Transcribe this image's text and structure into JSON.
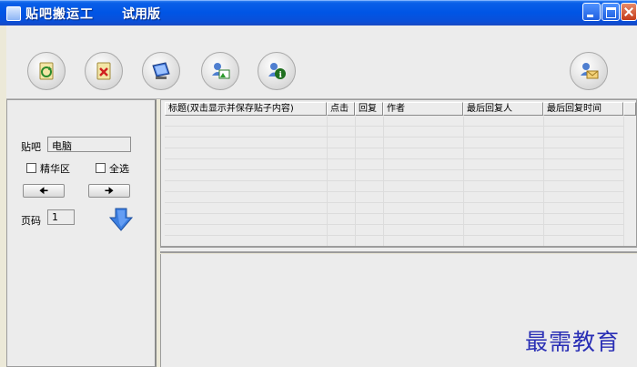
{
  "window": {
    "title": "贴吧搬运工",
    "edition": "试用版"
  },
  "toolbar": {
    "buttons": [
      {
        "icon": "refresh-document-icon"
      },
      {
        "icon": "delete-document-icon"
      },
      {
        "icon": "monitor-icon"
      },
      {
        "icon": "user-image-icon"
      },
      {
        "icon": "user-info-icon"
      },
      {
        "icon": "user-mail-icon"
      }
    ]
  },
  "left": {
    "tieba_label": "贴吧",
    "tieba_value": "电脑",
    "jinghua_label": "精华区",
    "select_all_label": "全选",
    "prev_symbol": "🠈",
    "next_symbol": "🠊",
    "page_label": "页码",
    "page_value": "1"
  },
  "table": {
    "columns": [
      "标题(双击显示并保存贴子内容)",
      "点击",
      "回复",
      "作者",
      "最后回复人",
      "最后回复时间"
    ]
  },
  "watermark": "最需教育"
}
